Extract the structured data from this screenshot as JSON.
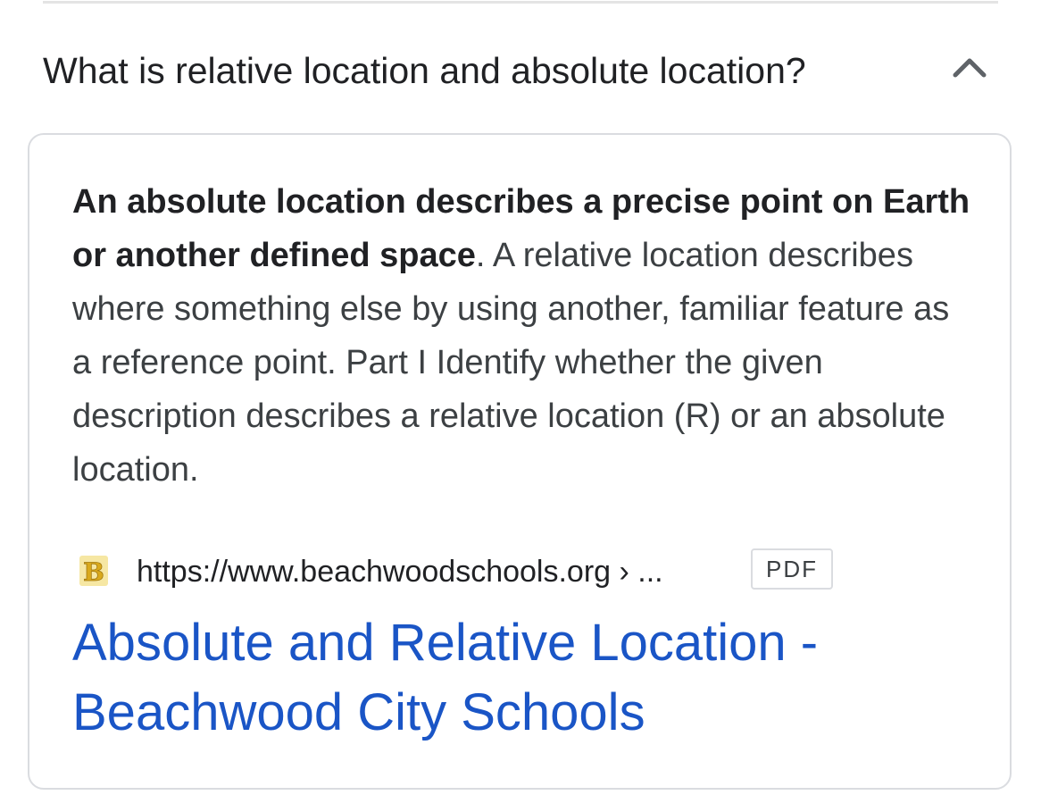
{
  "faq": {
    "question": "What is relative location and absolute location?",
    "toggle_icon": "chevron-up-icon",
    "expanded": true
  },
  "answer": {
    "bold_text": "An absolute location describes a precise point on Earth or another defined space",
    "rest_text": ". A relative location describes where something else by using another, familiar feature as a reference point. Part I Identify whether the given description describes a relative location (R) or an absolute location."
  },
  "source": {
    "favicon_letter": "B",
    "favicon_color": "#e8c23a",
    "url": "https://www.beachwoodschools.org › ...",
    "badge": "PDF"
  },
  "result": {
    "title": "Absolute and Relative Location - Beachwood City Schools",
    "link_color": "#1a55c6"
  }
}
